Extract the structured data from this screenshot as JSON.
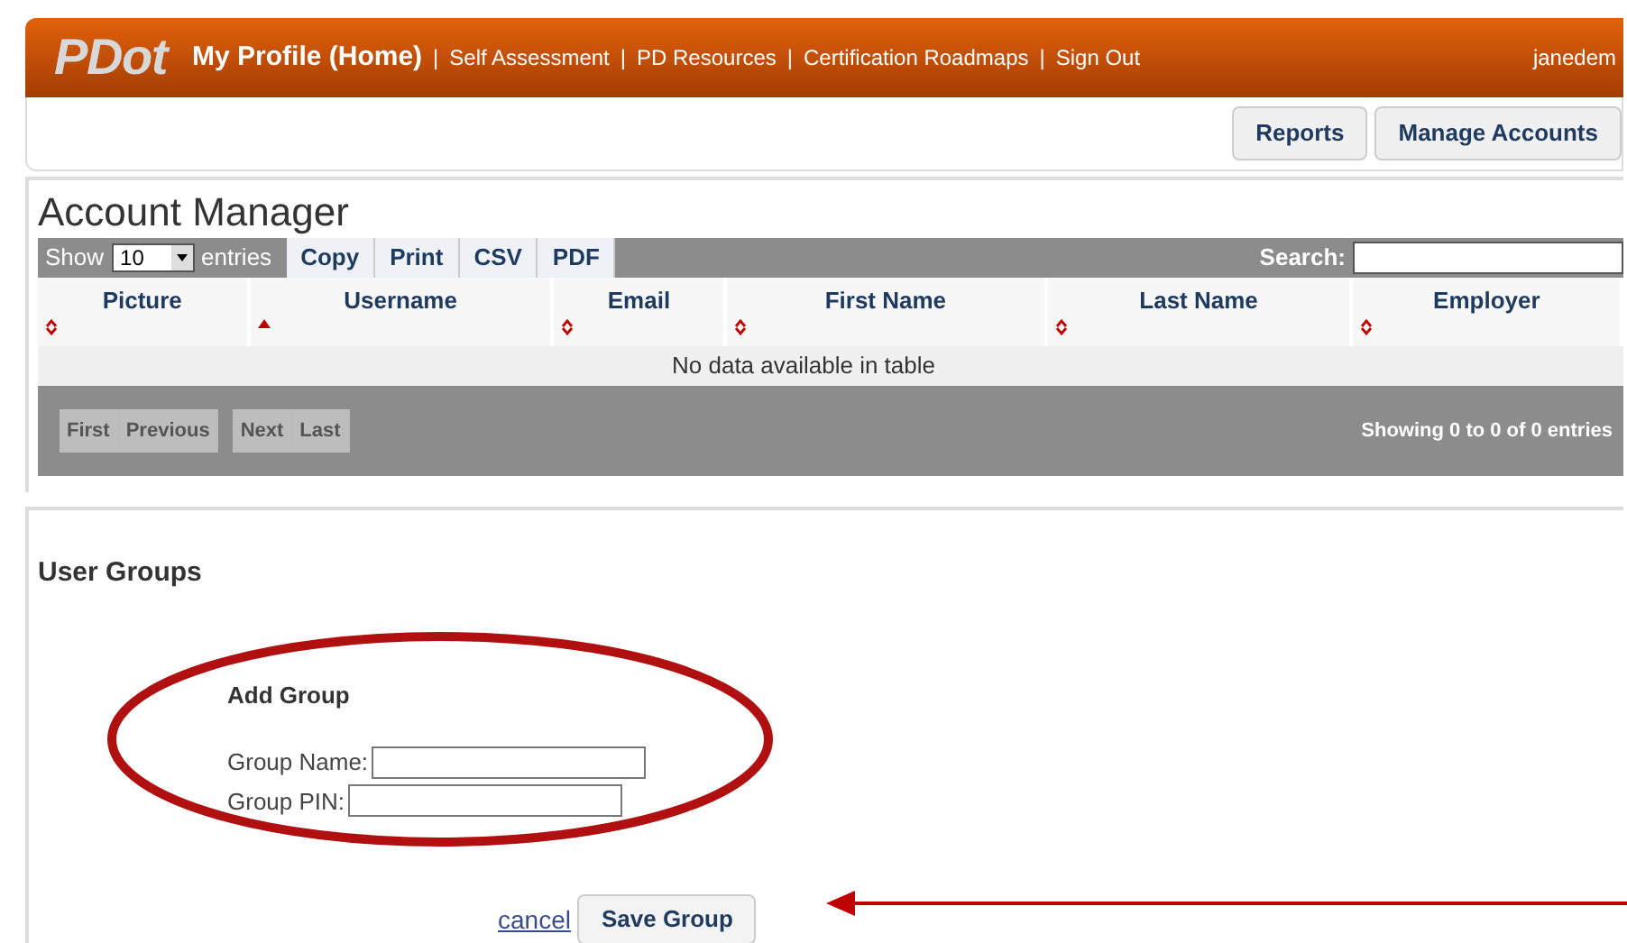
{
  "header": {
    "logo": "PDot",
    "user": "janedem",
    "nav": [
      {
        "kind": "link",
        "label": "My Profile (Home)",
        "current": true
      },
      {
        "kind": "separator",
        "label": "|"
      },
      {
        "kind": "link",
        "label": "Self Assessment",
        "current": false
      },
      {
        "kind": "separator",
        "label": "|"
      },
      {
        "kind": "link",
        "label": "PD Resources",
        "current": false
      },
      {
        "kind": "separator",
        "label": "|"
      },
      {
        "kind": "link",
        "label": "Certification Roadmaps",
        "current": false
      },
      {
        "kind": "separator",
        "label": "|"
      },
      {
        "kind": "link",
        "label": "Sign Out",
        "current": false
      }
    ]
  },
  "toolbar": {
    "buttons": [
      "Reports",
      "Manage Accounts"
    ]
  },
  "account_manager": {
    "title": "Account Manager",
    "show_label": "Show",
    "page_size": "10",
    "entries_label": "entries",
    "export_buttons": [
      "Copy",
      "Print",
      "CSV",
      "PDF"
    ],
    "search_label": "Search:",
    "columns": [
      {
        "label": "Picture",
        "sorted": false
      },
      {
        "label": "Username",
        "sorted": true
      },
      {
        "label": "Email",
        "sorted": false
      },
      {
        "label": "First Name",
        "sorted": false
      },
      {
        "label": "Last Name",
        "sorted": false
      },
      {
        "label": "Employer",
        "sorted": false
      }
    ],
    "empty_message": "No data available in table",
    "pagination": [
      {
        "label": "First",
        "disabled": true
      },
      {
        "label": "Previous",
        "disabled": true
      },
      {
        "label": "Next",
        "disabled": true
      },
      {
        "label": "Last",
        "disabled": true
      }
    ],
    "info": "Showing 0 to 0 of 0 entries"
  },
  "user_groups": {
    "title": "User Groups",
    "form_title": "Add Group",
    "fields": [
      {
        "label": "Group Name:"
      },
      {
        "label": "Group PIN:"
      }
    ],
    "cancel": "cancel",
    "save": "Save Group"
  }
}
